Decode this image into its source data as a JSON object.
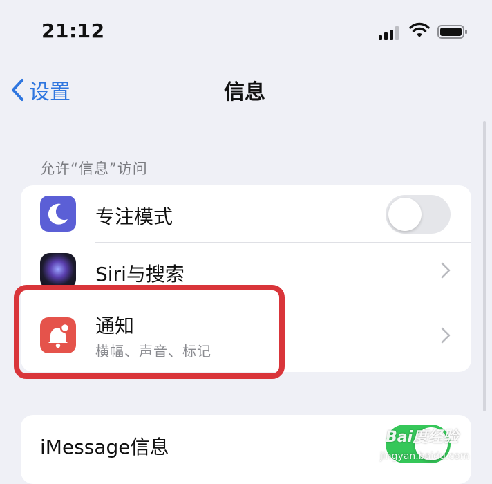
{
  "status_bar": {
    "time": "21:12",
    "icons": [
      "cellular-signal-icon",
      "wifi-icon",
      "battery-icon"
    ]
  },
  "nav": {
    "back_label": "设置",
    "title": "信息",
    "accent_color": "#2f76df"
  },
  "section": {
    "header": "允许“信息”访问"
  },
  "rows": [
    {
      "label": "专注模式",
      "icon": "moon-icon",
      "icon_color": "#5b5fd6",
      "control": "toggle",
      "toggle_on": false
    },
    {
      "label": "Siri与搜索",
      "icon": "siri-icon",
      "control": "chevron"
    },
    {
      "label": "通知",
      "subtitle": "横幅、声音、标记",
      "icon": "notification-bell-icon",
      "icon_color": "#e5534b",
      "control": "chevron",
      "highlighted": true
    }
  ],
  "imessage": {
    "label": "iMessage信息",
    "toggle_on": true,
    "toggle_color": "#35c759"
  },
  "highlight_color": "#d9353a",
  "watermark": {
    "main": "Bai度经验",
    "sub": "jingyan.baidu.com"
  }
}
